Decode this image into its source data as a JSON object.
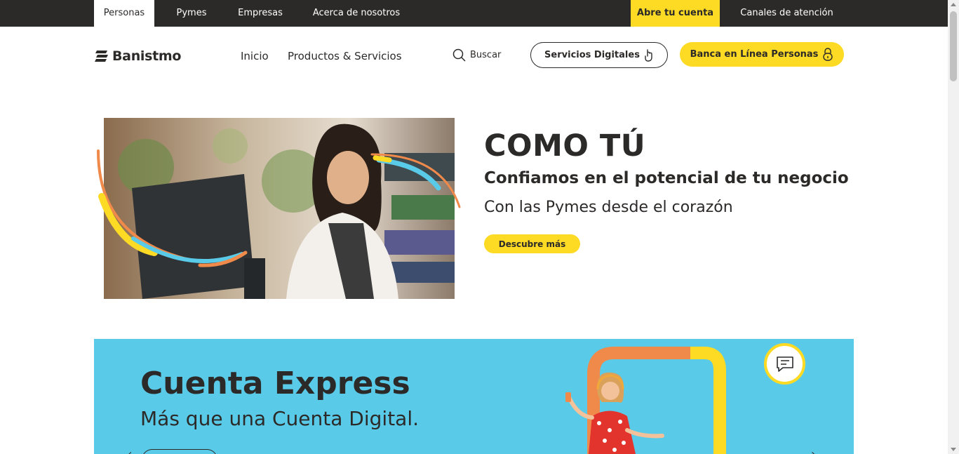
{
  "topbar": {
    "tabs": [
      "Personas",
      "Pymes",
      "Empresas",
      "Acerca de nosotros"
    ],
    "cta": "Abre tu cuenta",
    "channels": "Canales de atención"
  },
  "header": {
    "logo": "Banistmo",
    "nav": [
      "Inicio",
      "Productos & Servicios"
    ],
    "search_label": "Buscar",
    "digital_services": "Servicios Digitales",
    "online_banking": "Banca en Línea Personas"
  },
  "hero": {
    "title": "COMO TÚ",
    "subtitle": "Confiamos en el potencial de tu negocio",
    "text": "Con las Pymes desde el corazón",
    "button": "Descubre más"
  },
  "banner": {
    "title": "Cuenta Express",
    "subtitle": "Más que una Cuenta Digital.",
    "prev_icon": "chevron-left-icon",
    "next_icon": "chevron-right-icon"
  },
  "colors": {
    "brand_yellow": "#fdda24",
    "dark": "#2c2a29",
    "banner_blue": "#59cbe8",
    "accent_orange": "#f08a4b"
  }
}
